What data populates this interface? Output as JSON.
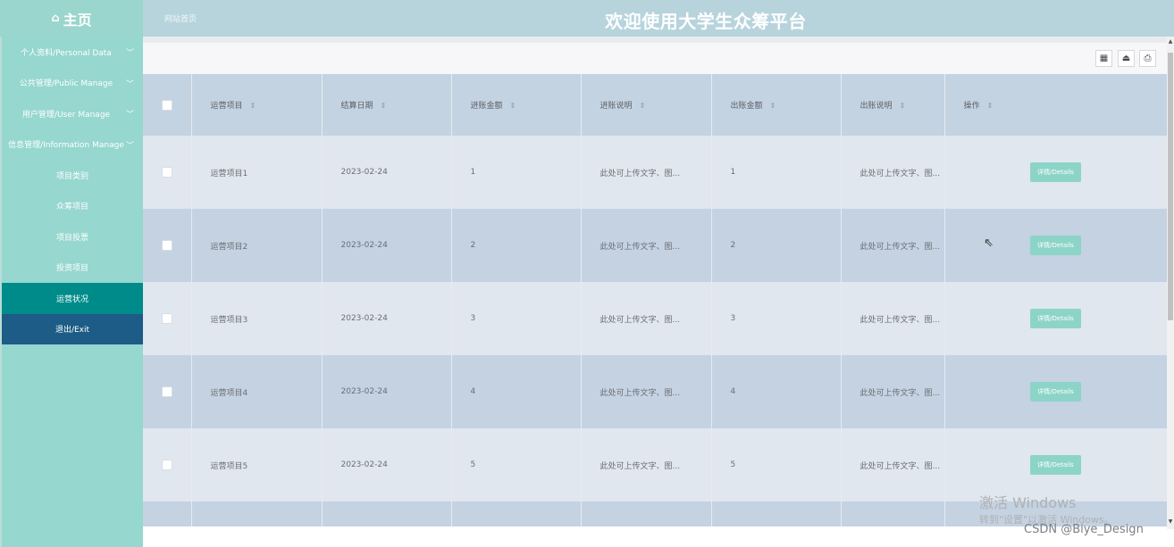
{
  "header": {
    "home_label": "主页",
    "home_icon": "home-icon",
    "site_link": "网站首页",
    "title": "欢迎使用大学生众筹平台"
  },
  "sidebar": {
    "menus": [
      {
        "label": "个人资料/Personal Data"
      },
      {
        "label": "公共管理/Public Manage"
      },
      {
        "label": "用户管理/User Manage"
      },
      {
        "label": "信息管理/Information Manage"
      }
    ],
    "subitems": [
      {
        "label": "项目类别"
      },
      {
        "label": "众筹项目"
      },
      {
        "label": "项目投票"
      },
      {
        "label": "投资项目"
      },
      {
        "label": "运营状况",
        "active": true
      },
      {
        "label": "退出/Exit"
      }
    ]
  },
  "toolbar": {
    "icons": [
      "columns-icon",
      "export-icon",
      "print-icon"
    ]
  },
  "table": {
    "columns": [
      "运营项目",
      "结算日期",
      "进账金额",
      "进账说明",
      "出账金额",
      "出账说明",
      "操作"
    ],
    "rows": [
      {
        "project": "运营项目1",
        "date": "2023-02-24",
        "income": "1",
        "income_note": "此处可上传文字、图...",
        "expense": "1",
        "expense_note": "此处可上传文字、图...",
        "action": "详情/Details"
      },
      {
        "project": "运营项目2",
        "date": "2023-02-24",
        "income": "2",
        "income_note": "此处可上传文字、图...",
        "expense": "2",
        "expense_note": "此处可上传文字、图...",
        "action": "详情/Details"
      },
      {
        "project": "运营项目3",
        "date": "2023-02-24",
        "income": "3",
        "income_note": "此处可上传文字、图...",
        "expense": "3",
        "expense_note": "此处可上传文字、图...",
        "action": "详情/Details"
      },
      {
        "project": "运营项目4",
        "date": "2023-02-24",
        "income": "4",
        "income_note": "此处可上传文字、图...",
        "expense": "4",
        "expense_note": "此处可上传文字、图...",
        "action": "详情/Details"
      },
      {
        "project": "运营项目5",
        "date": "2023-02-24",
        "income": "5",
        "income_note": "此处可上传文字、图...",
        "expense": "5",
        "expense_note": "此处可上传文字、图...",
        "action": "详情/Details"
      }
    ]
  },
  "watermark": {
    "line1": "激活 Windows",
    "line2": "转到\"设置\"以激活 Windows。"
  },
  "credit": "CSDN @Biye_Design",
  "colors": {
    "header": "#b7d4dd",
    "sidebar": "#96d7cf",
    "active_item": "#008b8b",
    "exit_item": "#1c5c86",
    "detail_button": "#8dd4c8"
  }
}
